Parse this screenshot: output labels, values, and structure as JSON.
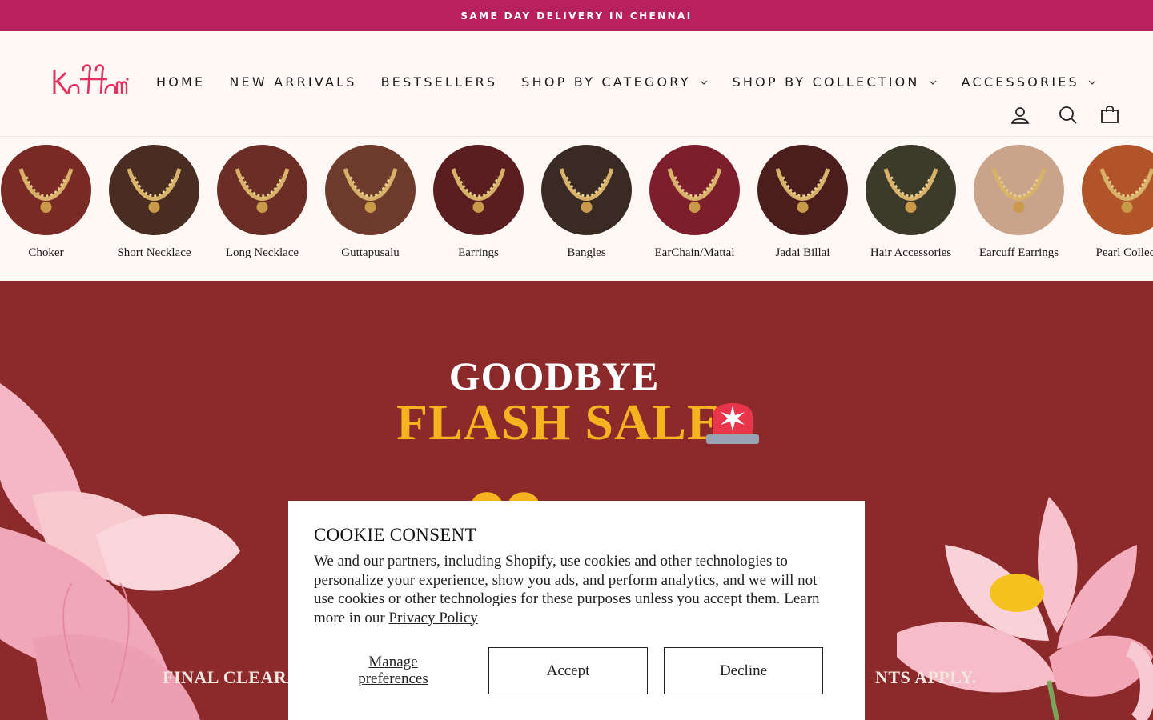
{
  "announcement": "SAME DAY DELIVERY IN CHENNAI",
  "brand": {
    "logo_text": "Kattam",
    "color": "#e0315f"
  },
  "nav": [
    {
      "label": "HOME",
      "dropdown": false
    },
    {
      "label": "NEW ARRIVALS",
      "dropdown": false
    },
    {
      "label": "BESTSELLERS",
      "dropdown": false
    },
    {
      "label": "SHOP BY CATEGORY",
      "dropdown": true
    },
    {
      "label": "SHOP BY COLLECTION",
      "dropdown": true
    },
    {
      "label": "ACCESSORIES",
      "dropdown": true
    }
  ],
  "header_icons": [
    "account-icon",
    "search-icon",
    "cart-icon"
  ],
  "categories": [
    {
      "label": "Choker",
      "bg": "#7a2a24"
    },
    {
      "label": "Short Necklace",
      "bg": "#4a2d22"
    },
    {
      "label": "Long Necklace",
      "bg": "#6a2e26"
    },
    {
      "label": "Guttapusalu",
      "bg": "#6e3a2c"
    },
    {
      "label": "Earrings",
      "bg": "#5a1e20"
    },
    {
      "label": "Bangles",
      "bg": "#3a2a24"
    },
    {
      "label": "EarChain/Mattal",
      "bg": "#7d1e2c"
    },
    {
      "label": "Jadai Billai",
      "bg": "#4a1e1c"
    },
    {
      "label": "Hair Accessories",
      "bg": "#3c3a2a"
    },
    {
      "label": "Earcuff Earrings",
      "bg": "#c9a38a"
    },
    {
      "label": "Pearl Collect",
      "bg": "#b2542a"
    }
  ],
  "hero": {
    "line1": "GOODBYE",
    "line2": "FLASH SALE",
    "bottom_left": "FINAL CLEARAN",
    "bottom_right": "NTS APPLY.",
    "bg": "#8c292b",
    "accent": "#f5b31f"
  },
  "cookie": {
    "title": "COOKIE CONSENT",
    "body": "We and our partners, including Shopify, use cookies and other technologies to personalize your experience, show you ads, and perform analytics, and we will not use cookies or other technologies for these purposes unless you accept them. Learn more in our ",
    "link": "Privacy Policy",
    "manage_line1": "Manage",
    "manage_line2": "preferences",
    "accept": "Accept",
    "decline": "Decline"
  }
}
